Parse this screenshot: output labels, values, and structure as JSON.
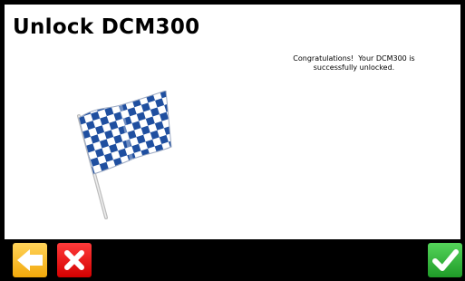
{
  "screen": {
    "title": "Unlock DCM300",
    "message_line1": "Congratulations!  Your DCM300 is",
    "message_line2": "successfully unlocked.",
    "illustration": "checkered-flag-icon"
  },
  "toolbar": {
    "back_icon": "arrow-left-icon",
    "cancel_icon": "close-icon",
    "confirm_icon": "checkmark-icon"
  },
  "colors": {
    "background": "#000000",
    "panel": "#ffffff",
    "back_button": "#f7b52b",
    "cancel_button": "#e21b1b",
    "confirm_button": "#2fb33a",
    "flag_check": "#1f4fa0"
  }
}
